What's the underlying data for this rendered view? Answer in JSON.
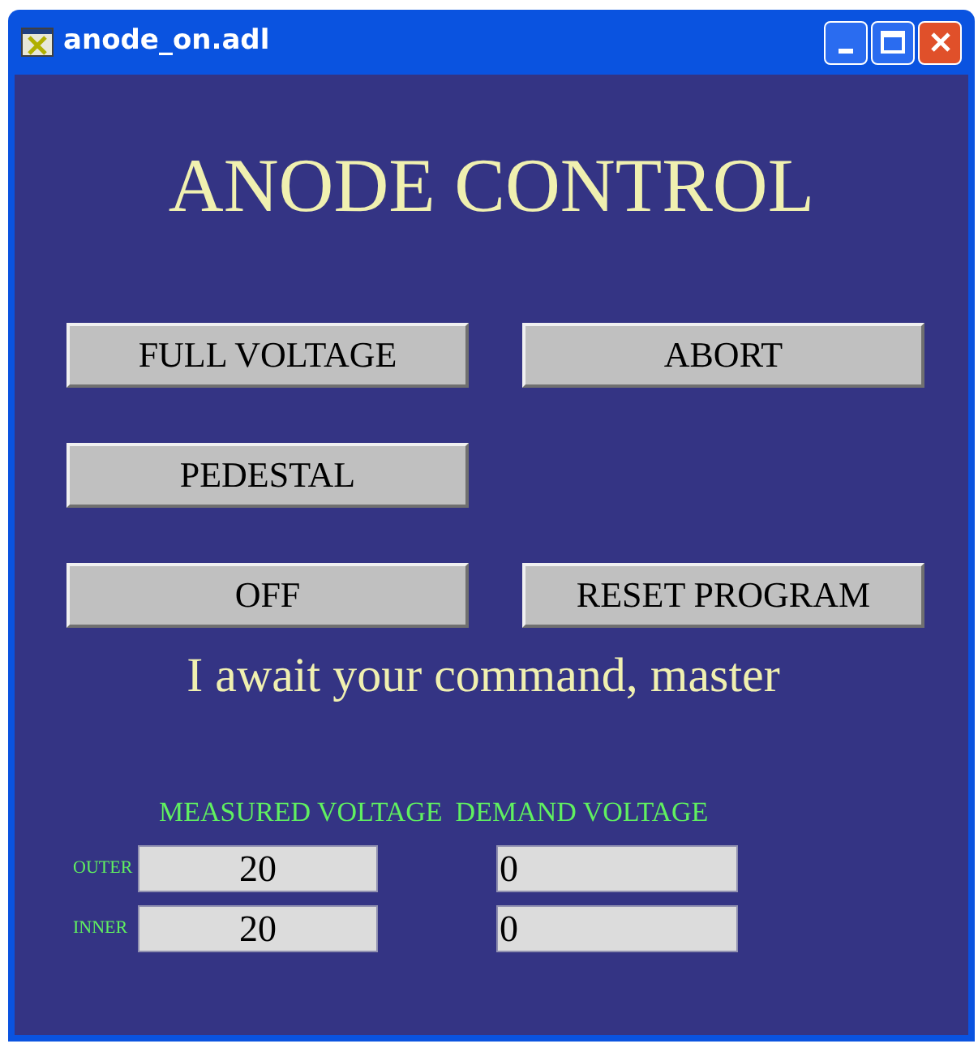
{
  "window": {
    "title": "anode_on.adl"
  },
  "heading": "ANODE CONTROL",
  "button_rows": [
    [
      "FULL VOLTAGE",
      "ABORT"
    ],
    [
      "PEDESTAL"
    ],
    [
      "OFF",
      "RESET PROGRAM"
    ]
  ],
  "message": "I await your command, master",
  "readback": {
    "columns": [
      "MEASURED VOLTAGE",
      "DEMAND VOLTAGE"
    ],
    "rows": [
      {
        "label": "OUTER",
        "measured": "20",
        "demand": "0"
      },
      {
        "label": "INNER",
        "measured": "20",
        "demand": "0"
      }
    ]
  }
}
